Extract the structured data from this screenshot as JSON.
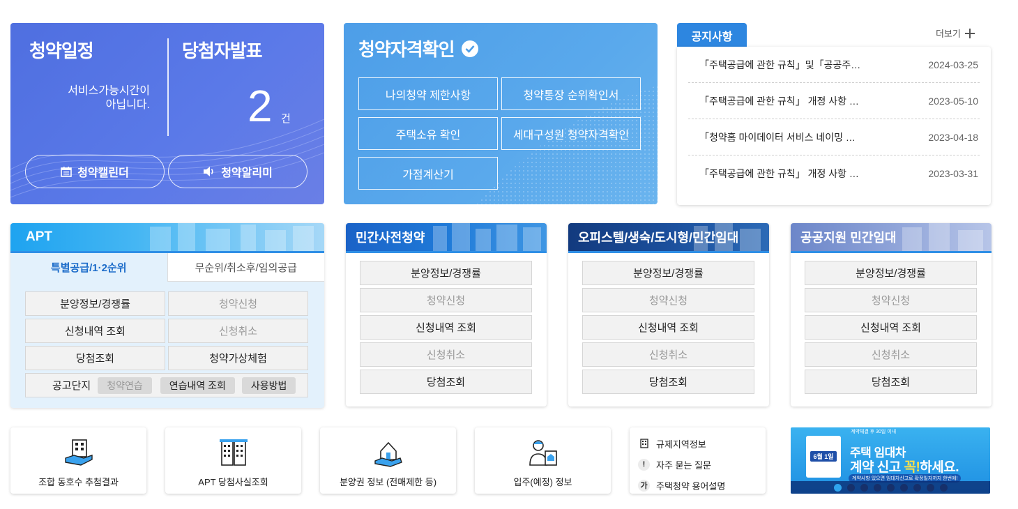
{
  "schedule": {
    "title": "청약일정",
    "message_line1": "서비스가능시간이",
    "message_line2": "아닙니다.",
    "winner_title": "당첨자발표",
    "winner_count": "2",
    "winner_unit": "건",
    "calendar_label": "청약캘린더",
    "alarm_label": "청약알리미"
  },
  "qualification": {
    "title": "청약자격확인",
    "buttons": [
      "나의청약 제한사항",
      "청약통장 순위확인서",
      "주택소유 확인",
      "세대구성원 청약자격확인",
      "가점계산기"
    ]
  },
  "notice": {
    "tab": "공지사항",
    "more": "더보기",
    "items": [
      {
        "title": "「주택공급에 관한 규칙」및「공공주…",
        "date": "2024-03-25"
      },
      {
        "title": "「주택공급에 관한 규칙」 개정 사항 …",
        "date": "2023-05-10"
      },
      {
        "title": "「청약홈 마이데이터 서비스 네이밍 …",
        "date": "2023-04-18"
      },
      {
        "title": "「주택공급에 관한 규칙」 개정 사항 …",
        "date": "2023-03-31"
      }
    ]
  },
  "apt": {
    "title": "APT",
    "tabs": [
      "특별공급/1·2순위",
      "무순위/취소후/임의공급"
    ],
    "buttons": [
      "분양정보/경쟁률",
      "청약신청",
      "신청내역 조회",
      "신청취소",
      "당첨조회",
      "청약가상체험"
    ],
    "bottom_label": "공고단지",
    "chips": [
      "청약연습",
      "연습내역 조회",
      "사용방법"
    ]
  },
  "panels": [
    {
      "title": "민간사전청약",
      "items": [
        "분양정보/경쟁률",
        "청약신청",
        "신청내역 조회",
        "신청취소",
        "당첨조회"
      ]
    },
    {
      "title": "오피스텔/생숙/도시형/민간임대",
      "items": [
        "분양정보/경쟁률",
        "청약신청",
        "신청내역 조회",
        "신청취소",
        "당첨조회"
      ]
    },
    {
      "title": "공공지원 민간임대",
      "items": [
        "분양정보/경쟁률",
        "청약신청",
        "신청내역 조회",
        "신청취소",
        "당첨조회"
      ]
    }
  ],
  "quick": [
    {
      "label": "조합 동호수 추첨결과",
      "icon": "building-hand-icon"
    },
    {
      "label": "APT 당첨사실조회",
      "icon": "apartment-icon"
    },
    {
      "label": "분양권 정보 (전매제한 등)",
      "icon": "house-hand-icon"
    },
    {
      "label": "입주(예정) 정보",
      "icon": "person-house-icon"
    }
  ],
  "links": [
    {
      "label": "규제지역정보",
      "icon": "building-small-icon"
    },
    {
      "label": "자주 묻는 질문",
      "badge": "!"
    },
    {
      "label": "주택청약 용어설명",
      "badge": "가"
    }
  ],
  "banner": {
    "small_top": "계약체결 후 30일 이내",
    "line1": "주택 임대차",
    "line2_a": "계약 신고 ",
    "line2_b": "꼭!",
    "line2_c": "하세요.",
    "sub": "계약사항 있으면 임대차신고로 확정일자까지 한번에!",
    "date": "6월 1일",
    "slide_count": 9,
    "active_slide": 0
  },
  "colors": {
    "schedule_bg": "#5473e4",
    "qual_bg": "#54a5ea",
    "notice_tab": "#2d86e0",
    "apt_active_tab": "#1c6cc9"
  }
}
